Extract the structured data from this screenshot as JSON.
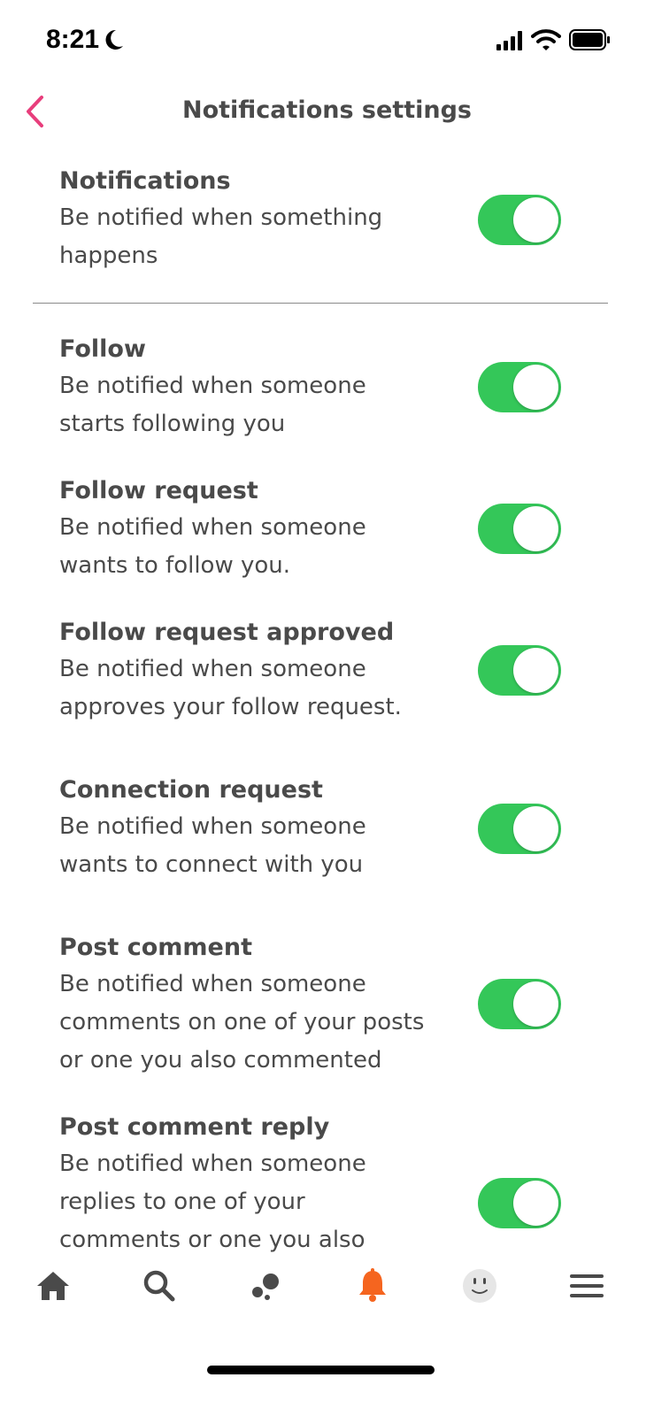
{
  "status_bar": {
    "time": "8:21",
    "icons": [
      "moon-icon",
      "signal-icon",
      "wifi-icon",
      "battery-icon"
    ]
  },
  "header": {
    "title": "Notifications settings",
    "back_icon": "chevron-left-icon",
    "accent_color": "#e83e7c"
  },
  "settings": [
    {
      "title": "Notifications",
      "lines": [
        "Be notified when something",
        "happens"
      ],
      "enabled": true
    },
    {
      "title": "Follow",
      "lines": [
        "Be notified when someone",
        "starts following you"
      ],
      "enabled": true
    },
    {
      "title": "Follow request",
      "lines": [
        "Be notified when someone",
        "wants to follow you."
      ],
      "enabled": true
    },
    {
      "title": "Follow request approved",
      "lines": [
        "Be notified when someone",
        "approves your follow request."
      ],
      "enabled": true
    },
    {
      "title": "Connection request",
      "lines": [
        "Be notified when someone",
        "wants to connect with you"
      ],
      "enabled": true
    },
    {
      "title": "Post comment",
      "lines": [
        "Be notified when someone",
        "comments on one of your posts",
        "or one you also commented"
      ],
      "enabled": true
    },
    {
      "title": "Post comment reply",
      "lines": [
        "Be notified when someone",
        "replies to one of your",
        "comments or one you also"
      ],
      "enabled": true
    }
  ],
  "toggle_color": "#34c759",
  "tab_bar": {
    "tabs": [
      "home-icon",
      "search-icon",
      "connections-icon",
      "bell-icon",
      "smiley-icon",
      "menu-icon"
    ],
    "active_tab": "bell-icon",
    "active_color": "#f5651f"
  }
}
